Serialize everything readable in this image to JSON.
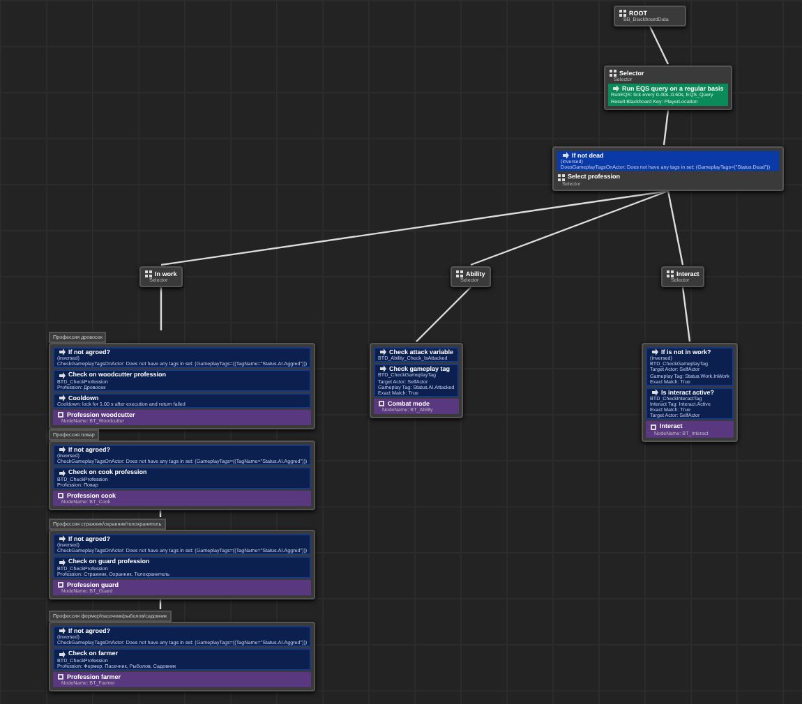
{
  "tree": {
    "kind": "root",
    "title": "ROOT",
    "subtitle": "BB_BlackboardData",
    "children": [
      {
        "kind": "composite",
        "title": "Selector",
        "subtitle": "Selector",
        "services": [
          {
            "title": "Run EQS query on a regular basis",
            "lines": [
              "RunEQS: tick every 0.40s..0.60s, EQS_Query",
              "Result Blackboard Key: PlayerLocation"
            ]
          }
        ],
        "children": [
          {
            "kind": "composite",
            "title": "Select profession",
            "subtitle": "Selector",
            "decorators": [
              {
                "title": "If not dead",
                "lines": [
                  "(inversed)",
                  "DoesGameplayTagsOnActor: Does not have any tags in set: (GameplayTags=(\"Status.Dead\"))"
                ]
              }
            ],
            "children": [
              {
                "kind": "composite",
                "title": "In work",
                "subtitle": "Selector",
                "children": [
                  {
                    "kind": "task",
                    "comment": "Профессия дровосек",
                    "title": "Profession woodcutter",
                    "subtitle": "NodeName: BT_Woodcutter",
                    "decorators": [
                      {
                        "title": "If not agroed?",
                        "lines": [
                          "(inversed)",
                          "CheckGameplayTagsOnActor: Does not have any tags in set: (GameplayTags=((TagName=\"Status.AI.Aggred\")))"
                        ]
                      },
                      {
                        "title": "Check on woodcutter profession",
                        "lines": [
                          "BTD_CheckProfession",
                          "Profession: Дровосек"
                        ]
                      },
                      {
                        "title": "Cooldown",
                        "lines": [
                          "Cooldown: lock for 1.00 s after execution and return failed"
                        ]
                      }
                    ]
                  },
                  {
                    "kind": "task",
                    "comment": "Профессия повар",
                    "title": "Profession cook",
                    "subtitle": "NodeName: BT_Cook",
                    "decorators": [
                      {
                        "title": "If not agroed?",
                        "lines": [
                          "(inversed)",
                          "CheckGameplayTagsOnActor: Does not have any tags in set: (GameplayTags=((TagName=\"Status.AI.Aggred\")))"
                        ]
                      },
                      {
                        "title": "Check on cook profession",
                        "lines": [
                          "BTD_CheckProfession",
                          "Profession: Повар"
                        ]
                      }
                    ]
                  },
                  {
                    "kind": "task",
                    "comment": "Профессия стражник/охранник/телохранитель",
                    "title": "Profession guard",
                    "subtitle": "NodeName: BT_Guard",
                    "decorators": [
                      {
                        "title": "If not agroed?",
                        "lines": [
                          "(inversed)",
                          "CheckGameplayTagsOnActor: Does not have any tags in set: (GameplayTags=((TagName=\"Status.AI.Aggred\")))"
                        ]
                      },
                      {
                        "title": "Check on guard profession",
                        "lines": [
                          "BTD_CheckProfession",
                          "Profession: Стражник, Охранник, Телохранитель"
                        ]
                      }
                    ]
                  },
                  {
                    "kind": "task",
                    "comment": "Профессия фермер/пасечник/рыболов/садовник",
                    "title": "Profession farmer",
                    "subtitle": "NodeName: BT_Farmer",
                    "decorators": [
                      {
                        "title": "If not agroed?",
                        "lines": [
                          "(inversed)",
                          "CheckGameplayTagsOnActor: Does not have any tags in set: (GameplayTags=((TagName=\"Status.AI.Aggred\")))"
                        ]
                      },
                      {
                        "title": "Check on farmer",
                        "lines": [
                          "BTD_CheckProfession",
                          "Profession: Фермер, Пасечник, Рыболов, Садовник"
                        ]
                      }
                    ]
                  }
                ]
              },
              {
                "kind": "composite",
                "title": "Ability",
                "subtitle": "Selector",
                "children": [
                  {
                    "kind": "task",
                    "title": "Combat mode",
                    "subtitle": "NodeName: BT_Ability",
                    "decorators": [
                      {
                        "title": "Check attack variable",
                        "lines": [
                          "BTD_Ability_Check_IsAttacked"
                        ]
                      },
                      {
                        "title": "Check gameplay tag",
                        "lines": [
                          "BTD_CheckGameplayTag",
                          "Target Actor: SelfActor",
                          "Gameplay Tag: Status.AI.Attacked",
                          "Exact Match: True"
                        ]
                      }
                    ]
                  }
                ]
              },
              {
                "kind": "composite",
                "title": "Interact",
                "subtitle": "Selector",
                "children": [
                  {
                    "kind": "task",
                    "title": "Interact",
                    "subtitle": "NodeName: BT_Interact",
                    "decorators": [
                      {
                        "title": "If is not in work?",
                        "lines": [
                          "(inversed)",
                          "BTD_CheckGameplayTag",
                          "Target Actor: SelfActor",
                          "Gameplay Tag: Status.Work.InWork",
                          "Exact Match: True"
                        ]
                      },
                      {
                        "title": "Is interact active?",
                        "lines": [
                          "BTD_CheckInteractTag",
                          "Interact Tag: Interact.Active",
                          "Exact Match: True",
                          "Target Actor: SelfActor"
                        ]
                      }
                    ]
                  }
                ]
              }
            ]
          }
        ]
      }
    ]
  }
}
